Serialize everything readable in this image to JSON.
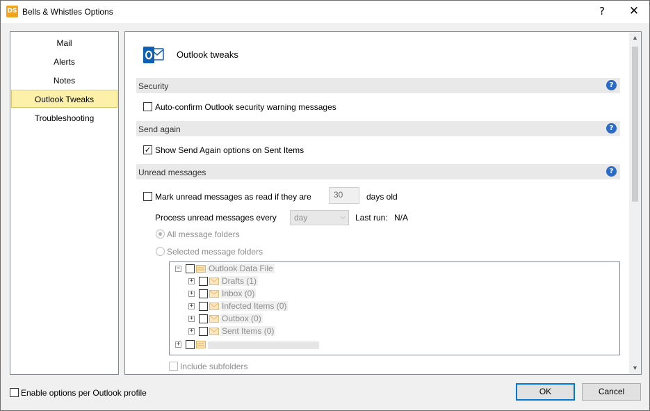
{
  "window": {
    "title": "Bells & Whistles Options",
    "app_icon_text": "DS",
    "help_glyph": "?",
    "close_glyph": "✕"
  },
  "nav": {
    "items": [
      {
        "label": "Mail"
      },
      {
        "label": "Alerts"
      },
      {
        "label": "Notes"
      },
      {
        "label": "Outlook Tweaks",
        "selected": true
      },
      {
        "label": "Troubleshooting"
      }
    ]
  },
  "header": {
    "title": "Outlook tweaks",
    "icon": "outlook-icon"
  },
  "sections": {
    "security": {
      "title": "Security",
      "auto_confirm": {
        "label": "Auto-confirm Outlook security warning messages",
        "checked": false
      }
    },
    "send_again": {
      "title": "Send again",
      "show_options": {
        "label": "Show Send Again options on Sent Items",
        "checked": true
      }
    },
    "unread": {
      "title": "Unread messages",
      "mark_read": {
        "label": "Mark unread messages as read if they are",
        "checked": false
      },
      "days_value": "30",
      "days_suffix": "days old",
      "process_label": "Process unread messages every",
      "process_value": "day",
      "last_run_label": "Last run:",
      "last_run_value": "N/A",
      "all_folders": {
        "label": "All message folders",
        "selected": true
      },
      "selected_folders": {
        "label": "Selected message folders",
        "selected": false
      },
      "include_subfolders": {
        "label": "Include subfolders",
        "checked": false
      }
    }
  },
  "tree": {
    "root": {
      "label": "Outlook Data File",
      "expander": "−"
    },
    "children": [
      {
        "label": "Drafts (1)",
        "expander": "+"
      },
      {
        "label": "Inbox (0)",
        "expander": "+"
      },
      {
        "label": "Infected Items (0)",
        "expander": "+"
      },
      {
        "label": "Outbox (0)",
        "expander": "+"
      },
      {
        "label": "Sent Items (0)",
        "expander": "+"
      }
    ],
    "second_root": {
      "expander": "+"
    }
  },
  "footer": {
    "per_profile": {
      "label": "Enable options per Outlook profile",
      "checked": false
    },
    "ok_label": "OK",
    "cancel_label": "Cancel"
  },
  "help_badge": "?",
  "check_glyph": "✓",
  "colors": {
    "accent": "#0078d7",
    "selected_nav_bg": "#fdf0a8",
    "help_badge": "#2a6cc7",
    "outlook_blue": "#0f5fb5",
    "folder_yellow": "#f3d08a"
  }
}
